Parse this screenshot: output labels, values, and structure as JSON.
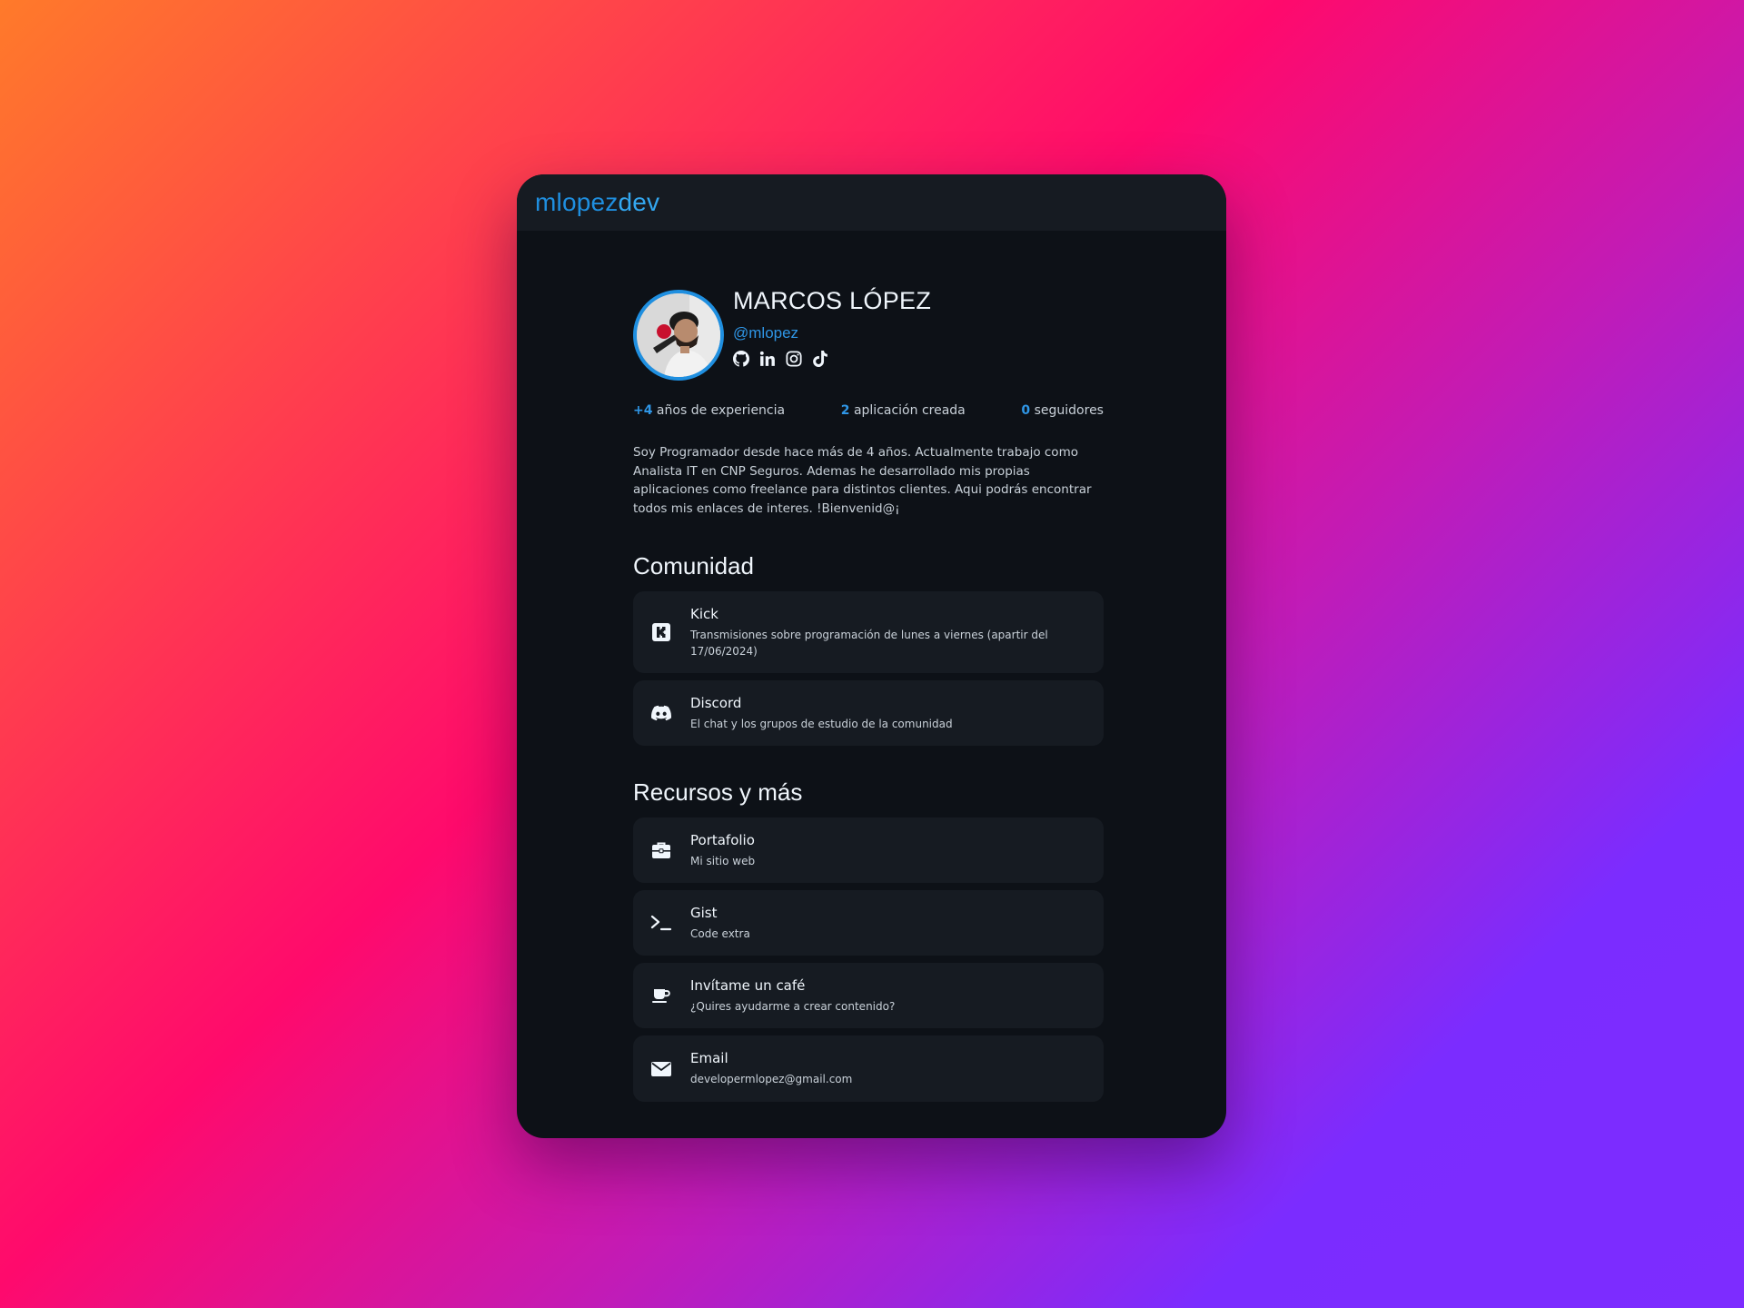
{
  "header": {
    "logo_part1": "mlopez",
    "logo_part2": "dev"
  },
  "profile": {
    "name": "MARCOS LÓPEZ",
    "handle": "@mlopez",
    "socials": [
      "github-icon",
      "linkedin-icon",
      "instagram-icon",
      "tiktok-icon"
    ]
  },
  "stats": [
    {
      "value": "+4",
      "label": " años de experiencia"
    },
    {
      "value": "2",
      "label": " aplicación creada"
    },
    {
      "value": "0",
      "label": " seguidores"
    }
  ],
  "bio": "Soy Programador desde hace más de 4 años. Actualmente trabajo como Analista IT en CNP Seguros. Ademas he desarrollado mis propias aplicaciones como freelance para distintos clientes. Aqui podrás encontrar todos mis enlaces de interes. !Bienvenid@¡",
  "sections": [
    {
      "title": "Comunidad",
      "links": [
        {
          "icon": "kick-icon",
          "title": "Kick",
          "description": "Transmisiones sobre programación de lunes a viernes (apartir del 17/06/2024)"
        },
        {
          "icon": "discord-icon",
          "title": "Discord",
          "description": "El chat y los grupos de estudio de la comunidad"
        }
      ]
    },
    {
      "title": "Recursos y más",
      "links": [
        {
          "icon": "briefcase-icon",
          "title": "Portafolio",
          "description": "Mi sitio web"
        },
        {
          "icon": "terminal-icon",
          "title": "Gist",
          "description": "Code extra"
        },
        {
          "icon": "coffee-icon",
          "title": "Invítame un café",
          "description": "¿Quires ayudarme a crear contenido?"
        },
        {
          "icon": "envelope-icon",
          "title": "Email",
          "description": "developermlopez@gmail.com"
        }
      ]
    }
  ],
  "colors": {
    "accent": "#1f8fe0",
    "card_bg": "#161b22",
    "page_bg": "#0d1117"
  }
}
